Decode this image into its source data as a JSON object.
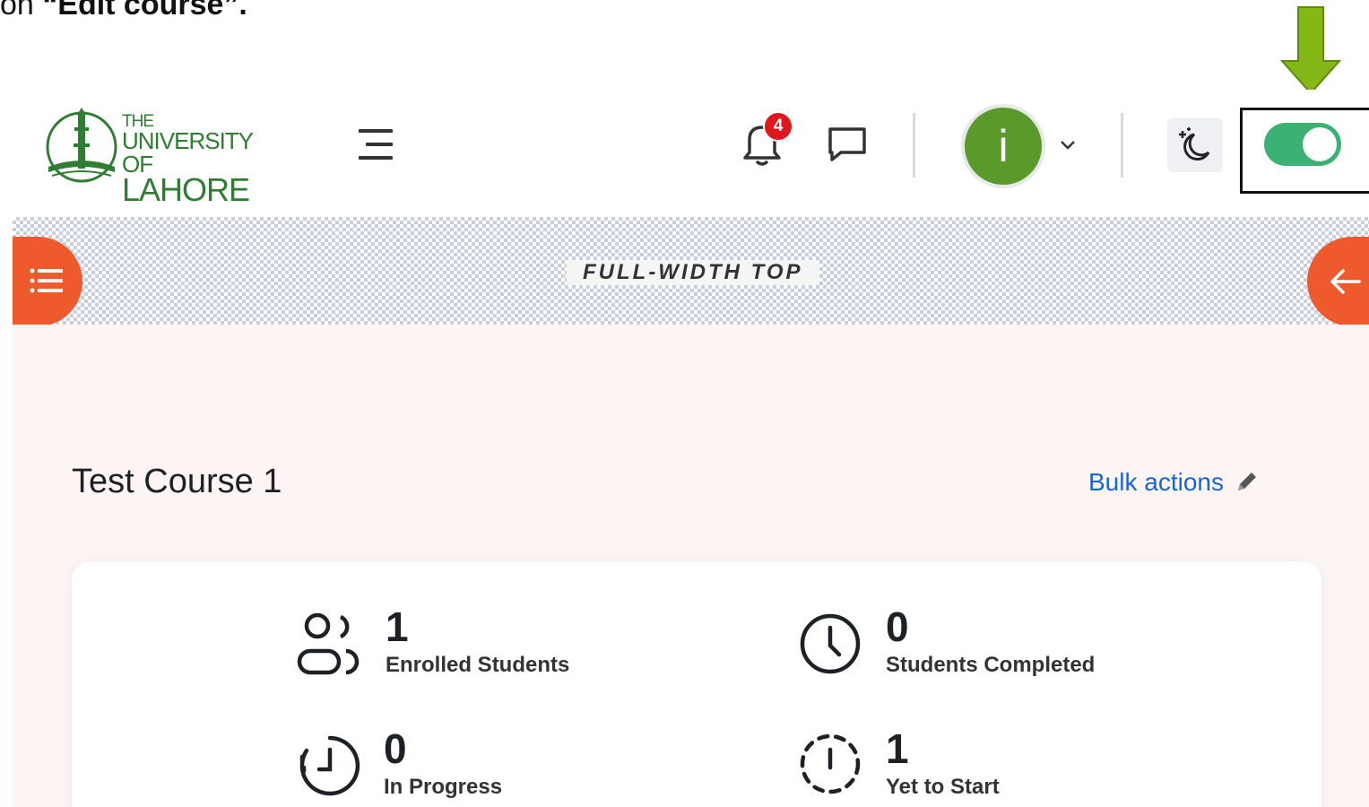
{
  "instruction": {
    "prefix": "on ",
    "bold": "“Edit course”."
  },
  "header": {
    "logo": {
      "line1": "THE",
      "line2": "UNIVERSITY OF",
      "line3": "LAHORE"
    },
    "notifications_count": "4",
    "avatar_initial": "i",
    "edit_mode_toggle_on": true
  },
  "banner": {
    "label": "FULL-WIDTH TOP"
  },
  "course": {
    "title": "Test Course 1",
    "bulk_actions_label": "Bulk actions"
  },
  "stats": [
    {
      "value": "1",
      "label": "Enrolled Students",
      "icon": "users-icon"
    },
    {
      "value": "0",
      "label": "Students Completed",
      "icon": "clock-icon"
    },
    {
      "value": "0",
      "label": "In Progress",
      "icon": "progress-clock-icon"
    },
    {
      "value": "1",
      "label": "Yet to Start",
      "icon": "dashed-timer-icon"
    }
  ],
  "colors": {
    "brand_green": "#2e7d32",
    "annotation_arrow": "#84b817",
    "toggle_on": "#3bb273",
    "drawer_orange": "#ee5a2c",
    "link_blue": "#1766d8",
    "badge_red": "#e0181e"
  }
}
